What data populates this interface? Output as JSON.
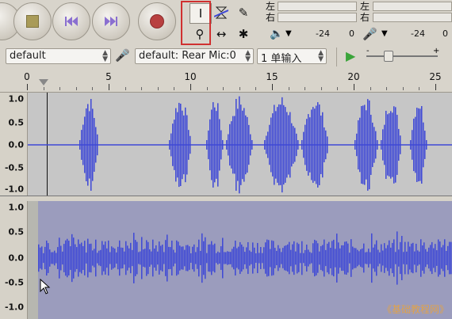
{
  "transport": {
    "buttons": [
      {
        "name": "pause-button",
        "icon": "pause-icon"
      },
      {
        "name": "stop-button",
        "icon": "stop-icon"
      },
      {
        "name": "skip-start-button",
        "icon": "skip-to-start-icon"
      },
      {
        "name": "skip-end-button",
        "icon": "skip-to-end-icon"
      },
      {
        "name": "record-button",
        "icon": "record-icon"
      }
    ]
  },
  "tools": {
    "selection": "I",
    "envelope": "envelope-icon",
    "draw": "✎",
    "zoom": "⚲",
    "timeshift": "↔",
    "multi": "✱"
  },
  "meters": {
    "playback": {
      "left_label": "左",
      "right_label": "右"
    },
    "record": {
      "left_label": "左",
      "right_label": "右"
    },
    "scale_left": [
      "-24",
      "0"
    ],
    "scale_right": [
      "-24",
      "0"
    ]
  },
  "devices": {
    "host": "default",
    "input_device": "default: Rear Mic:0",
    "channels": "1 单输入",
    "play_speed_slider": 0.1
  },
  "ruler": {
    "labels": [
      "0",
      "5",
      "10",
      "15",
      "20",
      "25"
    ]
  },
  "tracks": [
    {
      "name": "track-1",
      "labels": [
        "1.0",
        "0.5",
        "0.0",
        "-0.5",
        "-1.0"
      ]
    },
    {
      "name": "track-2",
      "labels": [
        "1.0",
        "0.5",
        "0.0",
        "-0.5",
        "-1.0"
      ]
    }
  ],
  "watermark": "《基础教程网》",
  "colors": {
    "wave": "#3e48d6",
    "track1_bg": "#c0c0c0",
    "track2_bg": "#9b9cbd",
    "selection_edge": "#b7b7b0"
  }
}
